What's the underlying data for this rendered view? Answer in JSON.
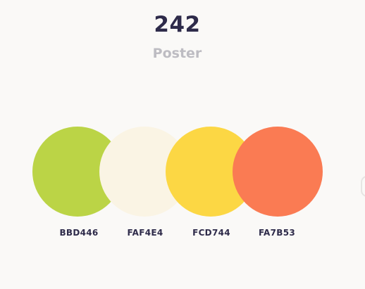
{
  "header": {
    "title": "242",
    "subtitle": "Poster"
  },
  "palette": [
    {
      "code": "BBD446",
      "color": "#BBD446"
    },
    {
      "code": "FAF4E4",
      "color": "#FAF4E4"
    },
    {
      "code": "FCD744",
      "color": "#FCD744"
    },
    {
      "code": "FA7B53",
      "color": "#FA7B53"
    }
  ],
  "colors": {
    "background": "#FAF9F7",
    "title_text": "#2E2B4A",
    "subtitle_text": "#BDBCC2"
  }
}
